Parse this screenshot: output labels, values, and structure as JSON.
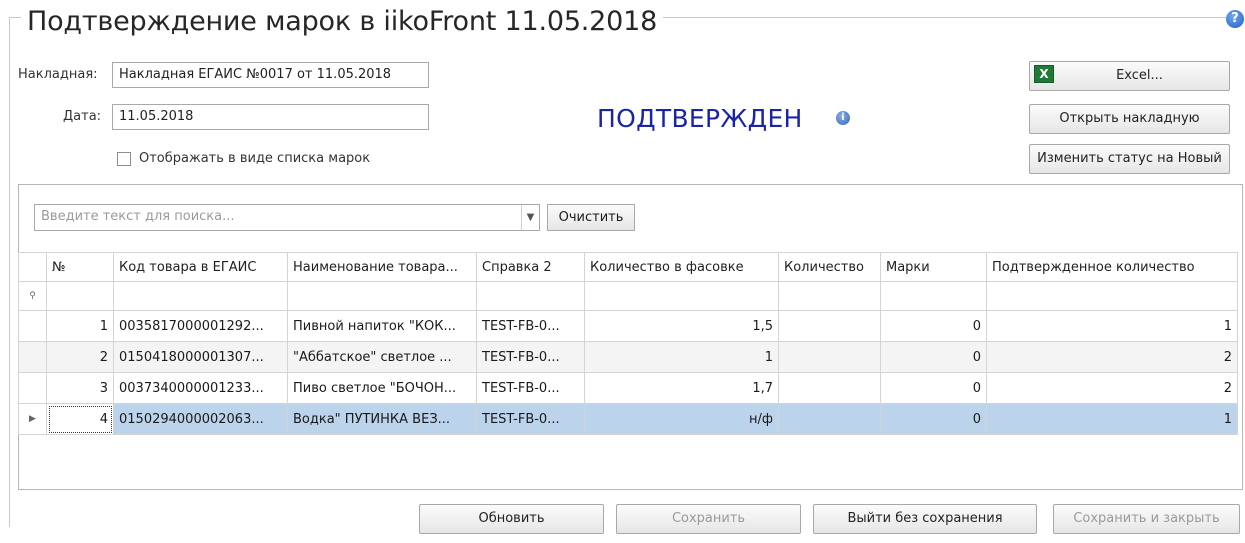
{
  "title": "Подтверждение марок в iikoFront 11.05.2018",
  "form": {
    "invoice_label": "Накладная:",
    "invoice_value": "Накладная ЕГАИС №0017 от 11.05.2018",
    "date_label": "Дата:",
    "date_value": "11.05.2018",
    "checkbox_label": "Отображать в виде списка марок"
  },
  "status": {
    "text": "ПОДТВЕРЖДЕН",
    "color": "#1b24a6"
  },
  "side_buttons": {
    "excel": "Excel...",
    "open_invoice": "Открыть накладную",
    "change_status": "Изменить статус на Новый"
  },
  "search": {
    "placeholder": "Введите текст для поиска...",
    "clear": "Очистить"
  },
  "table": {
    "headers": [
      "№",
      "Код товара в ЕГАИС",
      "Наименование товара...",
      "Справка 2",
      "Количество в фасовке",
      "Количество",
      "Марки",
      "Подтвержденное количество"
    ],
    "rows": [
      {
        "no": "1",
        "code": "0035817000001292...",
        "name": "Пивной напиток \"КОК...",
        "ref": "TEST-FB-0...",
        "pack": "1,5",
        "qty": "",
        "marks": "0",
        "confirmed": "1"
      },
      {
        "no": "2",
        "code": "0150418000001307...",
        "name": "\"Аббатское\" светлое ...",
        "ref": "TEST-FB-0...",
        "pack": "1",
        "qty": "",
        "marks": "0",
        "confirmed": "2"
      },
      {
        "no": "3",
        "code": "0037340000001233...",
        "name": "Пиво светлое \"БОЧОН...",
        "ref": "TEST-FB-0...",
        "pack": "1,7",
        "qty": "",
        "marks": "0",
        "confirmed": "2"
      },
      {
        "no": "4",
        "code": "0150294000002063...",
        "name": "Водка\" ПУТИНКА ВЕЗ...",
        "ref": "TEST-FB-0...",
        "pack": "н/ф",
        "qty": "",
        "marks": "0",
        "confirmed": "1"
      }
    ]
  },
  "bottom_buttons": {
    "refresh": "Обновить",
    "save": "Сохранить",
    "exit_no_save": "Выйти без сохранения",
    "save_close": "Сохранить и закрыть"
  },
  "colors": {
    "selected_row": "#bcd3ec",
    "accent": "#1b24a6"
  }
}
